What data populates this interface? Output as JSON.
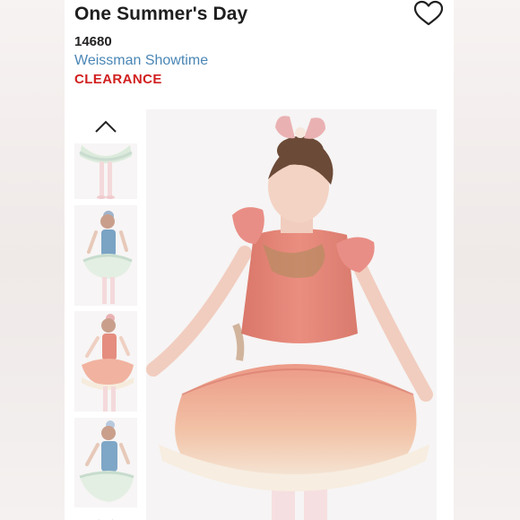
{
  "product": {
    "title": "One Summer's Day",
    "sku": "14680",
    "brand": "Weissman Showtime",
    "status_label": "CLEARANCE"
  },
  "icons": {
    "favorite": "heart-outline-icon",
    "thumb_prev": "chevron-up-icon",
    "thumb_next": "chevron-down-icon"
  },
  "gallery": {
    "thumbnails": [
      {
        "variant": "mint tutu (cropped)",
        "color": "#cfe3d6"
      },
      {
        "variant": "blue",
        "color": "#7aa3c4"
      },
      {
        "variant": "coral",
        "color": "#e58d7f"
      },
      {
        "variant": "blue",
        "color": "#7ea6c6"
      }
    ],
    "selected_index": 2
  },
  "colors": {
    "brand_link": "#4a86b5",
    "clearance": "#d11f1f",
    "title": "#1f1f1f",
    "bodice": "#e6897c",
    "tutu_top": "#ec9a87",
    "tutu_bottom": "#f5eadb",
    "bow": "#eab1b3"
  }
}
